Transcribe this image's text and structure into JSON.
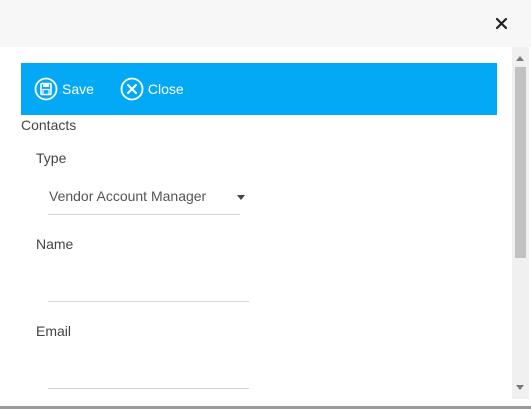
{
  "dialog": {
    "close_icon": "close-x-icon"
  },
  "toolbar": {
    "bg_color": "#03a9f4",
    "save_label": "Save",
    "save_icon": "save-floppy-circle-icon",
    "close_label": "Close",
    "close_icon": "close-circle-icon"
  },
  "form": {
    "section_title": "Contacts",
    "type_label": "Type",
    "type_value": "Vendor Account Manager",
    "name_label": "Name",
    "name_value": "",
    "email_label": "Email",
    "email_value": ""
  }
}
